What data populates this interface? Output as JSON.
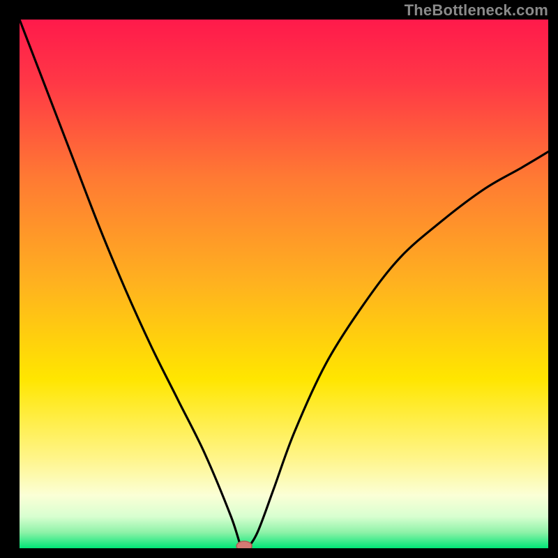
{
  "watermark": "TheBottleneck.com",
  "colors": {
    "frame": "#000000",
    "grad_top": "#ff1a4b",
    "grad_mid1": "#ff8a2a",
    "grad_mid2": "#ffe600",
    "grad_low": "#faffd0",
    "grad_bottom": "#00e676",
    "curve": "#000000",
    "marker_fill": "#d47a74",
    "marker_stroke": "#b35a54"
  },
  "chart_data": {
    "type": "line",
    "title": "",
    "xlabel": "",
    "ylabel": "",
    "xlim": [
      0,
      100
    ],
    "ylim": [
      0,
      100
    ],
    "grid": false,
    "legend": false,
    "notes": "V-shaped bottleneck curve; minimum marked with ellipse near x≈42, y≈0. Values estimated from pixels (axes unlabeled).",
    "series": [
      {
        "name": "bottleneck-curve",
        "x": [
          0,
          5,
          10,
          15,
          20,
          25,
          30,
          35,
          40,
          42,
          43,
          45,
          48,
          52,
          58,
          65,
          72,
          80,
          88,
          95,
          100
        ],
        "y": [
          100,
          87,
          74,
          61,
          49,
          38,
          28,
          18,
          6,
          0,
          0,
          3,
          11,
          22,
          35,
          46,
          55,
          62,
          68,
          72,
          75
        ]
      }
    ],
    "marker": {
      "x": 42.5,
      "y": 0
    }
  }
}
